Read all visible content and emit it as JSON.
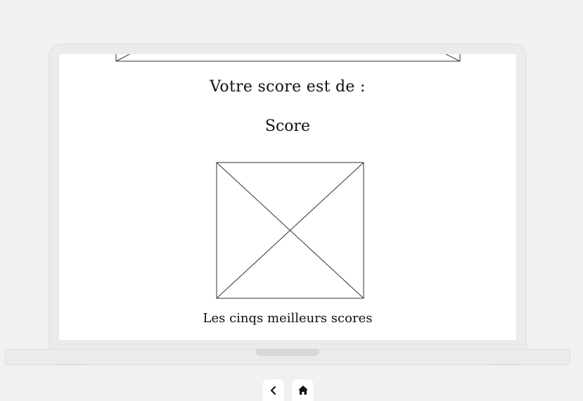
{
  "screen": {
    "score_heading": "Votre score est de :",
    "score_value": "Score",
    "top_scores_caption": "Les cinqs meilleurs scores"
  },
  "nav": {
    "back_icon": "chevron-left-icon",
    "home_icon": "home-icon"
  },
  "colors": {
    "background": "#f1f1f1",
    "device": "#ebebeb",
    "screen": "#ffffff",
    "ink": "#111111"
  }
}
